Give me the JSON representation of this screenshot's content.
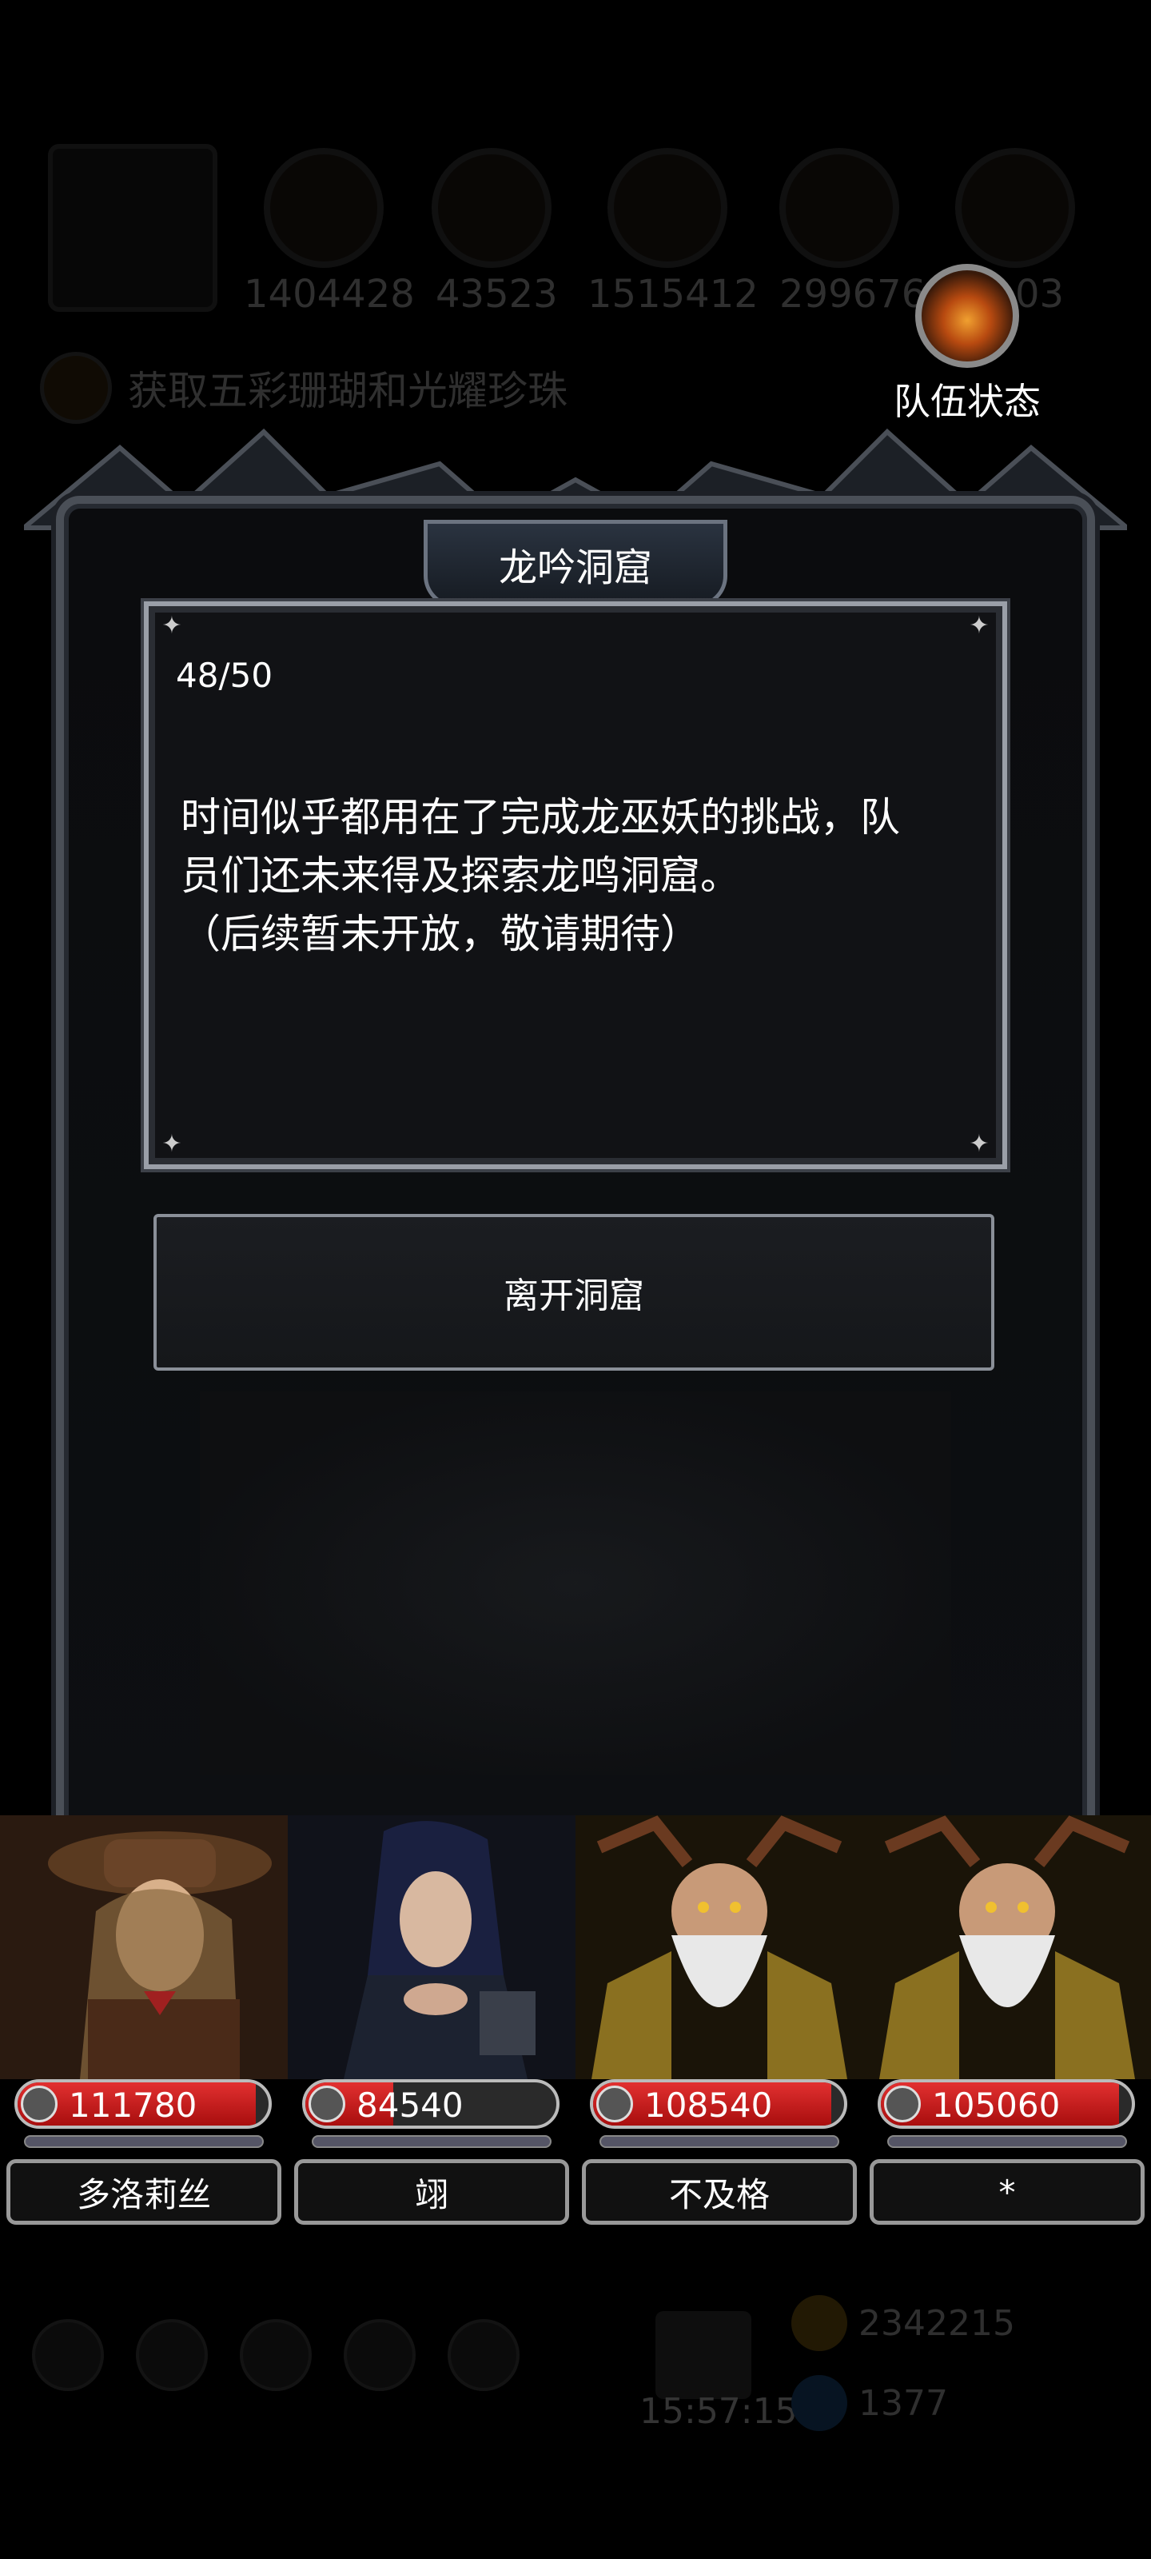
{
  "background_hud": {
    "resources": [
      "1404428",
      "43523",
      "1515412",
      "299676",
      "03"
    ],
    "quest": "获取五彩珊瑚和光耀珍珠",
    "clock": "15:57:15",
    "gold": "2342215",
    "gems": "1377"
  },
  "team_status": {
    "label": "队伍状态",
    "icon": "phoenix-icon"
  },
  "dialog": {
    "title": "龙吟洞窟",
    "progress": "48/50",
    "story_lines": [
      "时间似乎都用在了完成龙巫妖的挑战，队",
      "员们还未来得及探索龙鸣洞窟。",
      "（后续暂未开放，敬请期待）"
    ],
    "leave_button": "离开洞窟"
  },
  "heroes": [
    {
      "name": "多洛莉丝",
      "hp": "111780",
      "hp_fill": 0.95
    },
    {
      "name": "翊",
      "hp": "84540",
      "hp_fill": 0.35
    },
    {
      "name": "不及格",
      "hp": "108540",
      "hp_fill": 0.95
    },
    {
      "name": "*",
      "hp": "105060",
      "hp_fill": 0.95
    }
  ],
  "colors": {
    "hp_red": "#d01a1a",
    "frame": "#4a4f57",
    "panel": "#111215"
  }
}
